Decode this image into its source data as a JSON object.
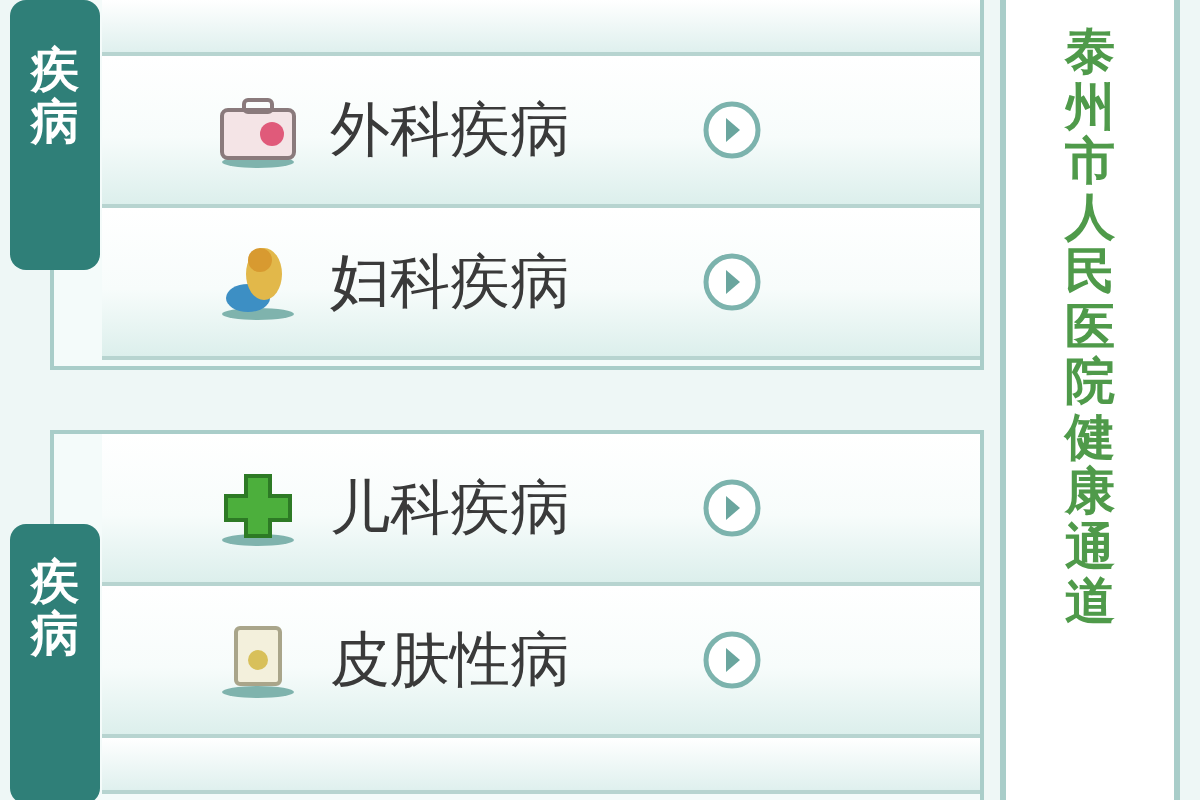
{
  "groups": [
    {
      "tab": "疾病",
      "items": [
        {
          "label": "外科疾病"
        },
        {
          "label": "妇科疾病"
        }
      ]
    },
    {
      "tab": "疾病",
      "items": [
        {
          "label": "儿科疾病"
        },
        {
          "label": "皮肤性病"
        }
      ]
    }
  ],
  "side_title": "泰州市人民医院健康通道"
}
